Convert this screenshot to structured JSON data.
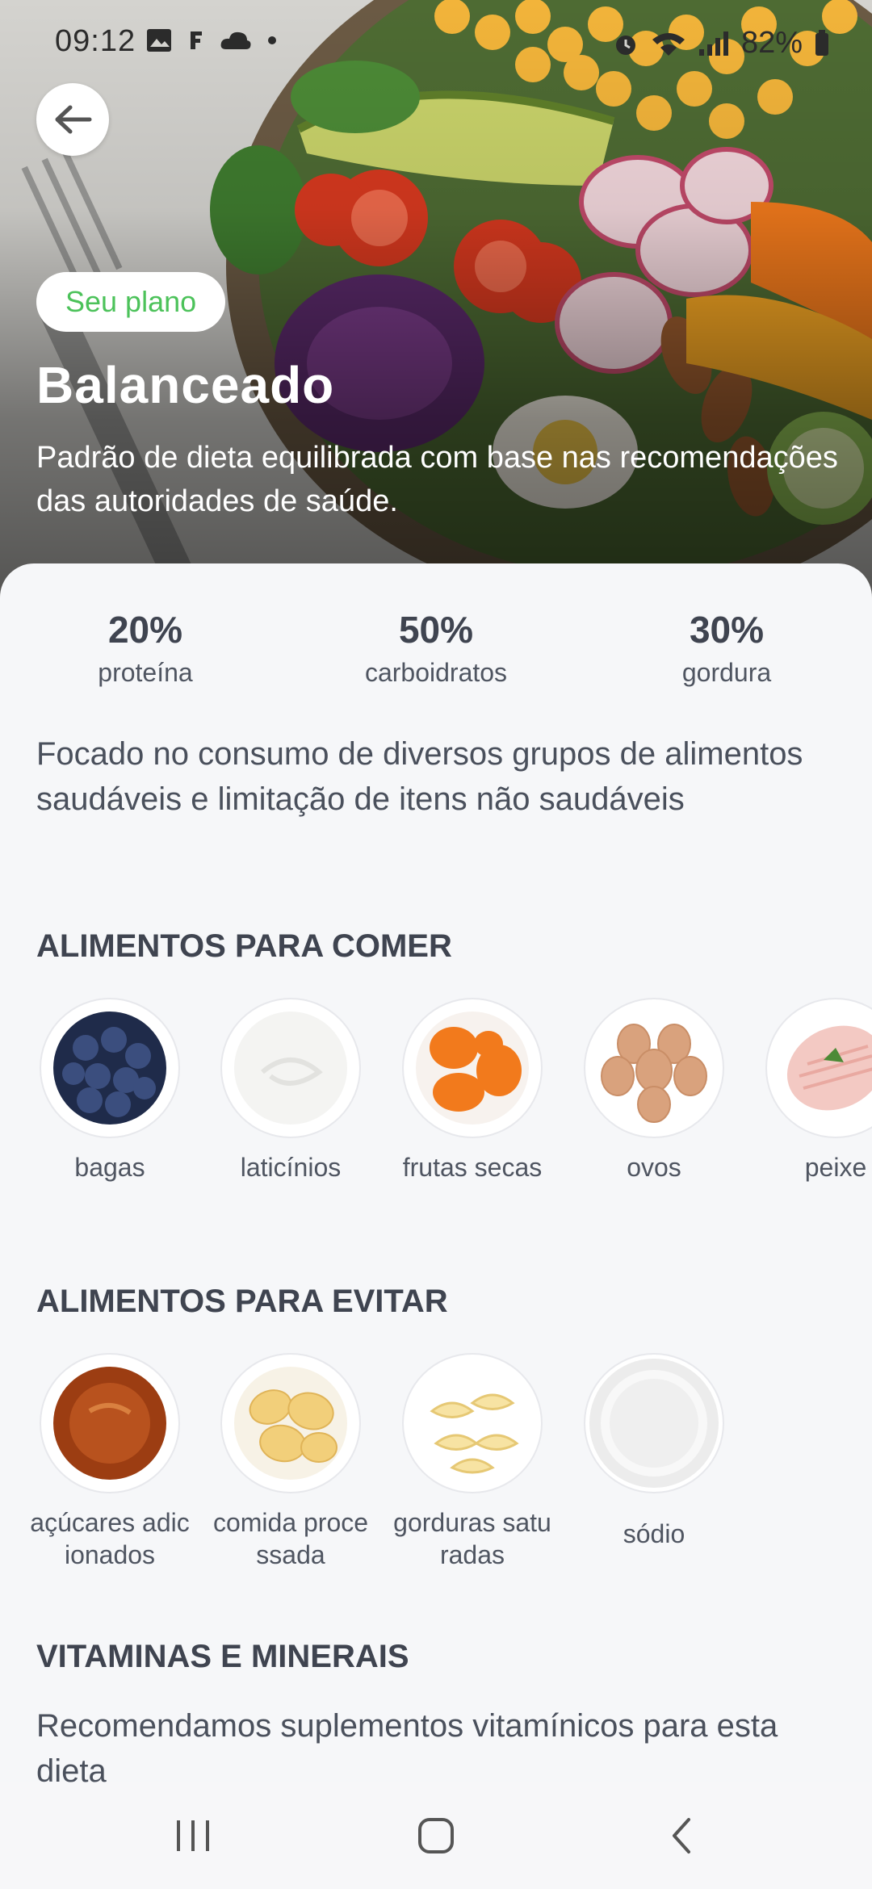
{
  "status_bar": {
    "time": "09:12",
    "left_icons": [
      "image-icon",
      "f-notification-icon",
      "cloud-icon",
      "dot-icon"
    ],
    "right_icons": [
      "alarm-icon",
      "wifi-icon",
      "signal-icon",
      "battery-icon"
    ],
    "battery": "82%"
  },
  "header": {
    "back_icon": "arrow-left-icon",
    "badge": "Seu plano",
    "title": "Balanceado",
    "description": "Padrão de dieta equilibrada com base nas recomendações das autoridades de saúde."
  },
  "macros": [
    {
      "value": "20%",
      "label": "proteína"
    },
    {
      "value": "50%",
      "label": "carboidratos"
    },
    {
      "value": "30%",
      "label": "gordura"
    }
  ],
  "focus_text": "Focado no consumo de diversos grupos de alimentos saudáveis e limitação de itens não saudáveis",
  "eat_section": {
    "title": "ALIMENTOS PARA COMER",
    "items": [
      {
        "label": "bagas",
        "icon": "blueberries-image"
      },
      {
        "label": "laticínios",
        "icon": "yogurt-image"
      },
      {
        "label": "frutas secas",
        "icon": "dried-apricots-image"
      },
      {
        "label": "ovos",
        "icon": "eggs-image"
      },
      {
        "label": "peixe",
        "icon": "fish-image"
      }
    ]
  },
  "avoid_section": {
    "title": "ALIMENTOS PARA EVITAR",
    "items": [
      {
        "label": "açúcares adicionados",
        "icon": "caramel-image"
      },
      {
        "label": "comida processada",
        "icon": "chips-image"
      },
      {
        "label": "gorduras saturadas",
        "icon": "butter-image"
      },
      {
        "label": "sódio",
        "icon": "salt-image"
      }
    ]
  },
  "vitamins_section": {
    "title": "VITAMINAS E MINERAIS",
    "text": "Recomendamos suplementos vitamínicos para esta dieta"
  },
  "nav_bar": {
    "icons": [
      "recent-apps-icon",
      "home-icon",
      "back-nav-icon"
    ]
  },
  "colors": {
    "accent_green": "#4cc25a",
    "sheet_background": "#f6f7f9",
    "text_dark": "#3f4450"
  }
}
